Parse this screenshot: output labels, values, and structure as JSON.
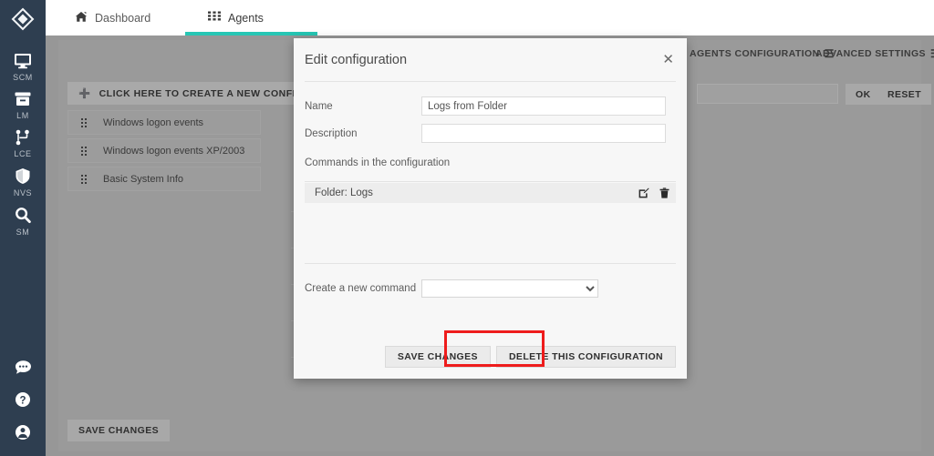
{
  "rail": {
    "logo_icon": "diamond-logo-icon",
    "items": [
      {
        "icon": "monitor-icon",
        "label": "SCM"
      },
      {
        "icon": "archive-box-icon",
        "label": "LM"
      },
      {
        "icon": "sitemap-branch-icon",
        "label": "LCE"
      },
      {
        "icon": "shield-icon",
        "label": "NVS"
      },
      {
        "icon": "magnifier-icon",
        "label": "SM"
      }
    ],
    "bottom_items": [
      {
        "icon": "chat-bubble-icon",
        "label": ""
      },
      {
        "icon": "help-circle-icon",
        "label": ""
      },
      {
        "icon": "user-circle-icon",
        "label": ""
      }
    ]
  },
  "topbar": {
    "tabs": [
      {
        "label": "Dashboard",
        "icon": "home-icon",
        "active": false
      },
      {
        "label": "Agents",
        "icon": "grid-icon",
        "active": true
      }
    ],
    "accent_color": "#26c6b4"
  },
  "background": {
    "headers": [
      {
        "label": "AGENTS CONFIGURATION",
        "icon": "hamburger-icon"
      },
      {
        "label": "ADVANCED SETTINGS",
        "icon": "hamburger-icon"
      }
    ],
    "create_button": "CLICK HERE TO CREATE A NEW CONFIGURATI",
    "create_icon": "plus-icon",
    "configurations": [
      "Windows logon events",
      "Windows logon events XP/2003",
      "Basic System Info"
    ],
    "search_value": "",
    "ok_button": "OK",
    "reset_button": "RESET",
    "save_changes_button": "SAVE CHANGES",
    "overlay_color": "#979797"
  },
  "modal": {
    "title": "Edit configuration",
    "close_icon": "close-icon",
    "name_label": "Name",
    "name_value": "Logs from Folder",
    "name_placeholder": "",
    "description_label": "Description",
    "description_value": "",
    "description_placeholder": "",
    "commands_section_label": "Commands in the configuration",
    "commands": [
      {
        "name": "Folder: Logs",
        "edit_icon": "edit-pencil-icon",
        "delete_icon": "trash-icon"
      }
    ],
    "new_command_label": "Create a new command",
    "new_command_value": "",
    "save_button": "SAVE CHANGES",
    "delete_button": "DELETE THIS CONFIGURATION"
  },
  "annotation": {
    "highlight_color": "#ee1c1c",
    "highlight_target": "save-changes-button"
  }
}
